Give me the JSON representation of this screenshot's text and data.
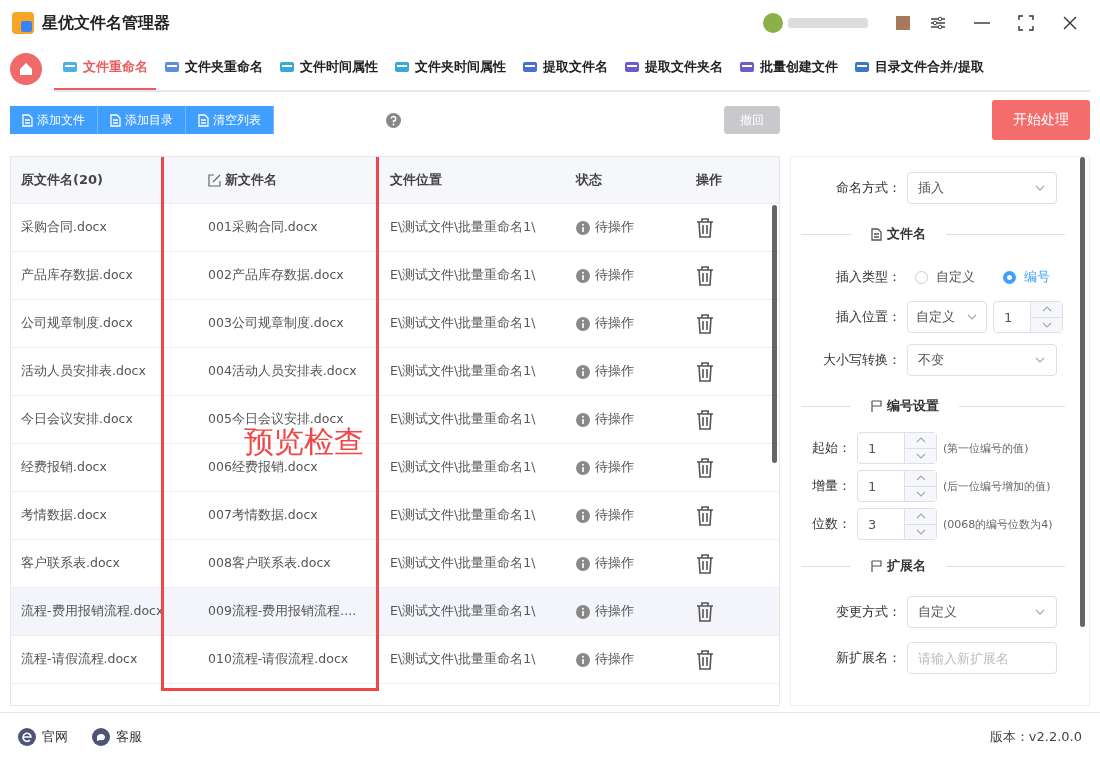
{
  "window": {
    "title": "星优文件名管理器"
  },
  "tabs": [
    {
      "label": "文件重命名",
      "selected": true
    },
    {
      "label": "文件夹重命名",
      "selected": false
    },
    {
      "label": "文件时间属性",
      "selected": false
    },
    {
      "label": "文件夹时间属性",
      "selected": false
    },
    {
      "label": "提取文件名",
      "selected": false
    },
    {
      "label": "提取文件夹名",
      "selected": false
    },
    {
      "label": "批量创建文件",
      "selected": false
    },
    {
      "label": "目录文件合并/提取",
      "selected": false
    }
  ],
  "toolbar": {
    "buttons": [
      "添加文件",
      "添加目录",
      "清空列表"
    ],
    "undo": {
      "label": "撤回",
      "disabled": true
    },
    "start": "开始处理"
  },
  "table": {
    "columns": [
      "原文件名(20)",
      "新文件名",
      "文件位置",
      "状态",
      "操作"
    ],
    "rows": [
      {
        "original": "采购合同.docx",
        "new": "001采购合同.docx",
        "location": "E\\测试文件\\批量重命名1\\",
        "status": "待操作",
        "selected": false
      },
      {
        "original": "产品库存数据.docx",
        "new": "002产品库存数据.docx",
        "location": "E\\测试文件\\批量重命名1\\",
        "status": "待操作",
        "selected": false
      },
      {
        "original": "公司规章制度.docx",
        "new": "003公司规章制度.docx",
        "location": "E\\测试文件\\批量重命名1\\",
        "status": "待操作",
        "selected": false
      },
      {
        "original": "活动人员安排表.docx",
        "new": "004活动人员安排表.docx",
        "location": "E\\测试文件\\批量重命名1\\",
        "status": "待操作",
        "selected": false
      },
      {
        "original": "今日会议安排.docx",
        "new": "005今日会议安排.docx",
        "location": "E\\测试文件\\批量重命名1\\",
        "status": "待操作",
        "selected": false
      },
      {
        "original": "经费报销.docx",
        "new": "006经费报销.docx",
        "location": "E\\测试文件\\批量重命名1\\",
        "status": "待操作",
        "selected": false
      },
      {
        "original": "考情数据.docx",
        "new": "007考情数据.docx",
        "location": "E\\测试文件\\批量重命名1\\",
        "status": "待操作",
        "selected": false
      },
      {
        "original": "客户联系表.docx",
        "new": "008客户联系表.docx",
        "location": "E\\测试文件\\批量重命名1\\",
        "status": "待操作",
        "selected": false
      },
      {
        "original": "流程-费用报销流程.docx",
        "new": "009流程-费用报销流程....",
        "location": "E\\测试文件\\批量重命名1\\",
        "status": "待操作",
        "selected": true
      },
      {
        "original": "流程-请假流程.docx",
        "new": "010流程-请假流程.docx",
        "location": "E\\测试文件\\批量重命名1\\",
        "status": "待操作",
        "selected": false
      }
    ]
  },
  "annotation": {
    "label": "预览检查"
  },
  "settings": [
    {
      "kind": "select",
      "label": "命名方式：",
      "value": "插入"
    },
    {
      "kind": "section",
      "label": "文件名"
    },
    {
      "kind": "radio",
      "label": "插入类型：",
      "options": [
        {
          "label": "自定义",
          "selected": false
        },
        {
          "label": "编号",
          "selected": true
        }
      ]
    },
    {
      "kind": "select_spin",
      "label": "插入位置：",
      "value": "自定义",
      "number": "1"
    },
    {
      "kind": "select",
      "label": "大小写转换：",
      "value": "不变"
    },
    {
      "kind": "section",
      "label": "编号设置"
    },
    {
      "kind": "spin",
      "label": "起始：",
      "value": "1",
      "hint": "(第一位编号的值)"
    },
    {
      "kind": "spin",
      "label": "增量：",
      "value": "1",
      "hint": "(后一位编号增加的值)"
    },
    {
      "kind": "spin",
      "label": "位数：",
      "value": "3",
      "hint": "(0068的编号位数为4)"
    },
    {
      "kind": "section",
      "label": "扩展名"
    },
    {
      "kind": "select",
      "label": "变更方式：",
      "value": "自定义"
    },
    {
      "kind": "input",
      "label": "新扩展名：",
      "placeholder": "请输入新扩展名"
    }
  ],
  "footer": {
    "links": [
      "官网",
      "客服"
    ],
    "version": "版本：v2.2.0.0"
  }
}
